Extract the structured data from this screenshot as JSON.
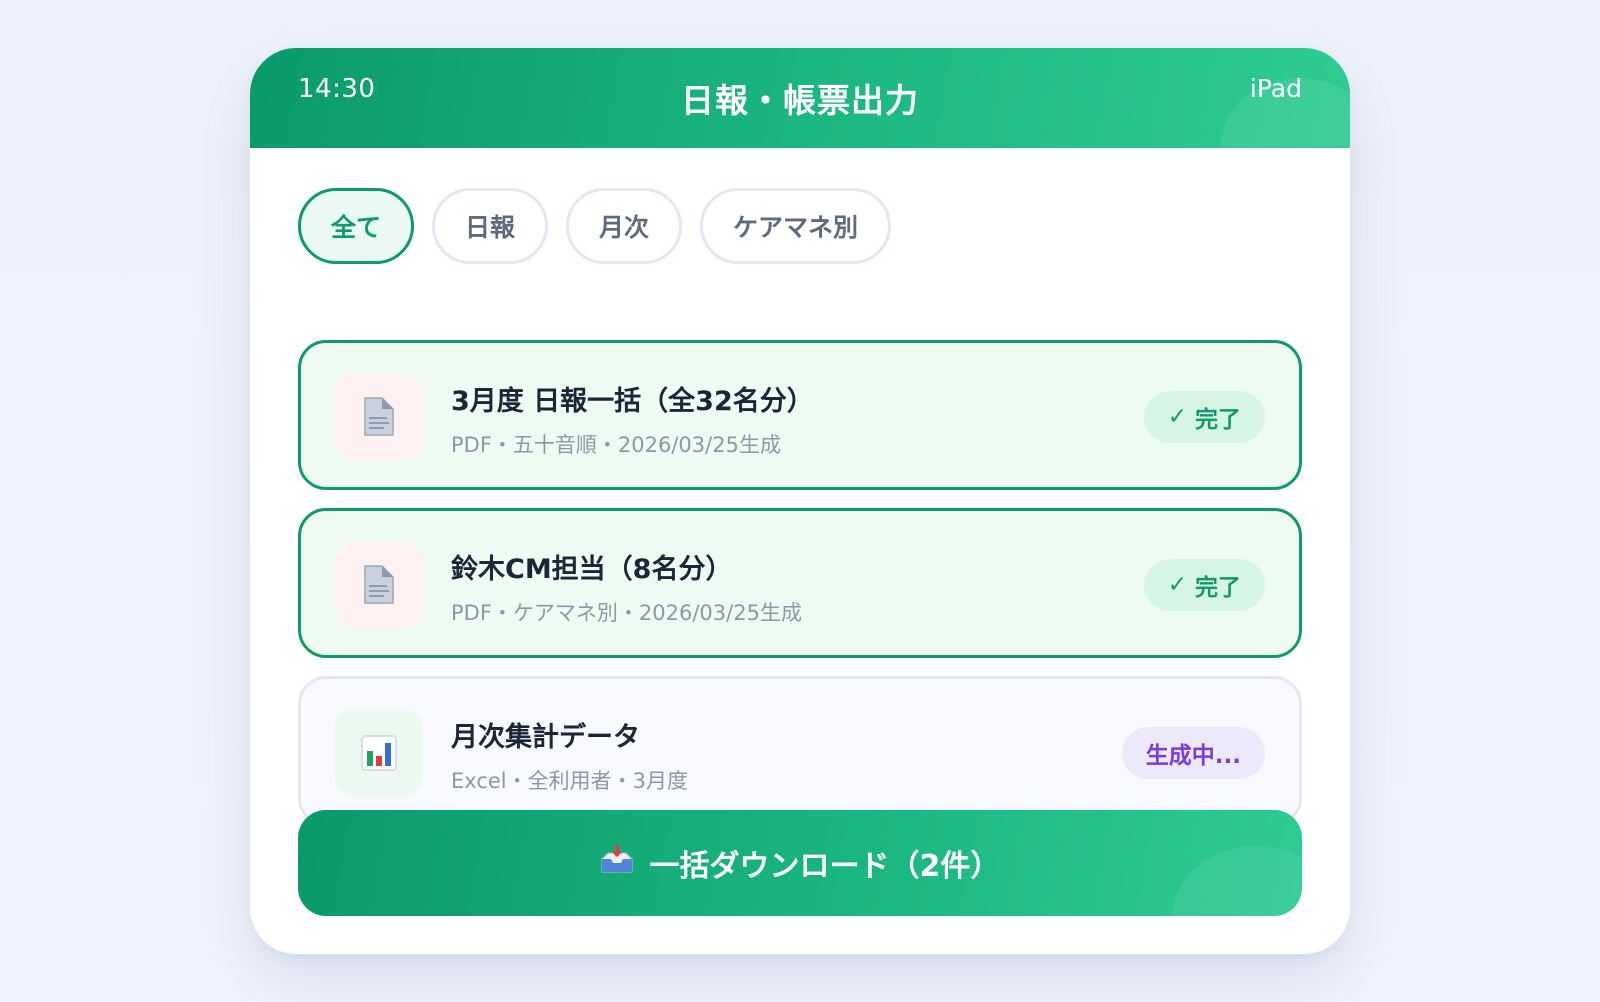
{
  "status_bar": {
    "time": "14:30",
    "device": "iPad"
  },
  "header": {
    "title": "日報・帳票出力"
  },
  "filters": [
    {
      "label": "全て",
      "active": true
    },
    {
      "label": "日報",
      "active": false
    },
    {
      "label": "月次",
      "active": false
    },
    {
      "label": "ケアマネ別",
      "active": false
    }
  ],
  "reports": [
    {
      "icon": "pdf-document-icon",
      "title": "3月度 日報一括（全32名分）",
      "meta": "PDF・五十音順・2026/03/25生成",
      "status": "完了",
      "status_type": "done"
    },
    {
      "icon": "pdf-document-icon",
      "title": "鈴木CM担当（8名分）",
      "meta": "PDF・ケアマネ別・2026/03/25生成",
      "status": "完了",
      "status_type": "done"
    },
    {
      "icon": "bar-chart-icon",
      "title": "月次集計データ",
      "meta": "Excel・全利用者・3月度",
      "status": "生成中...",
      "status_type": "generating"
    }
  ],
  "download_button": {
    "icon": "inbox-tray-icon",
    "label": "一括ダウンロード（2件）"
  },
  "colors": {
    "accent": "#0f9a6a",
    "accent_light": "#2ecb93",
    "done_background": "#edfbf3",
    "generating_text": "#7a3ae0"
  }
}
